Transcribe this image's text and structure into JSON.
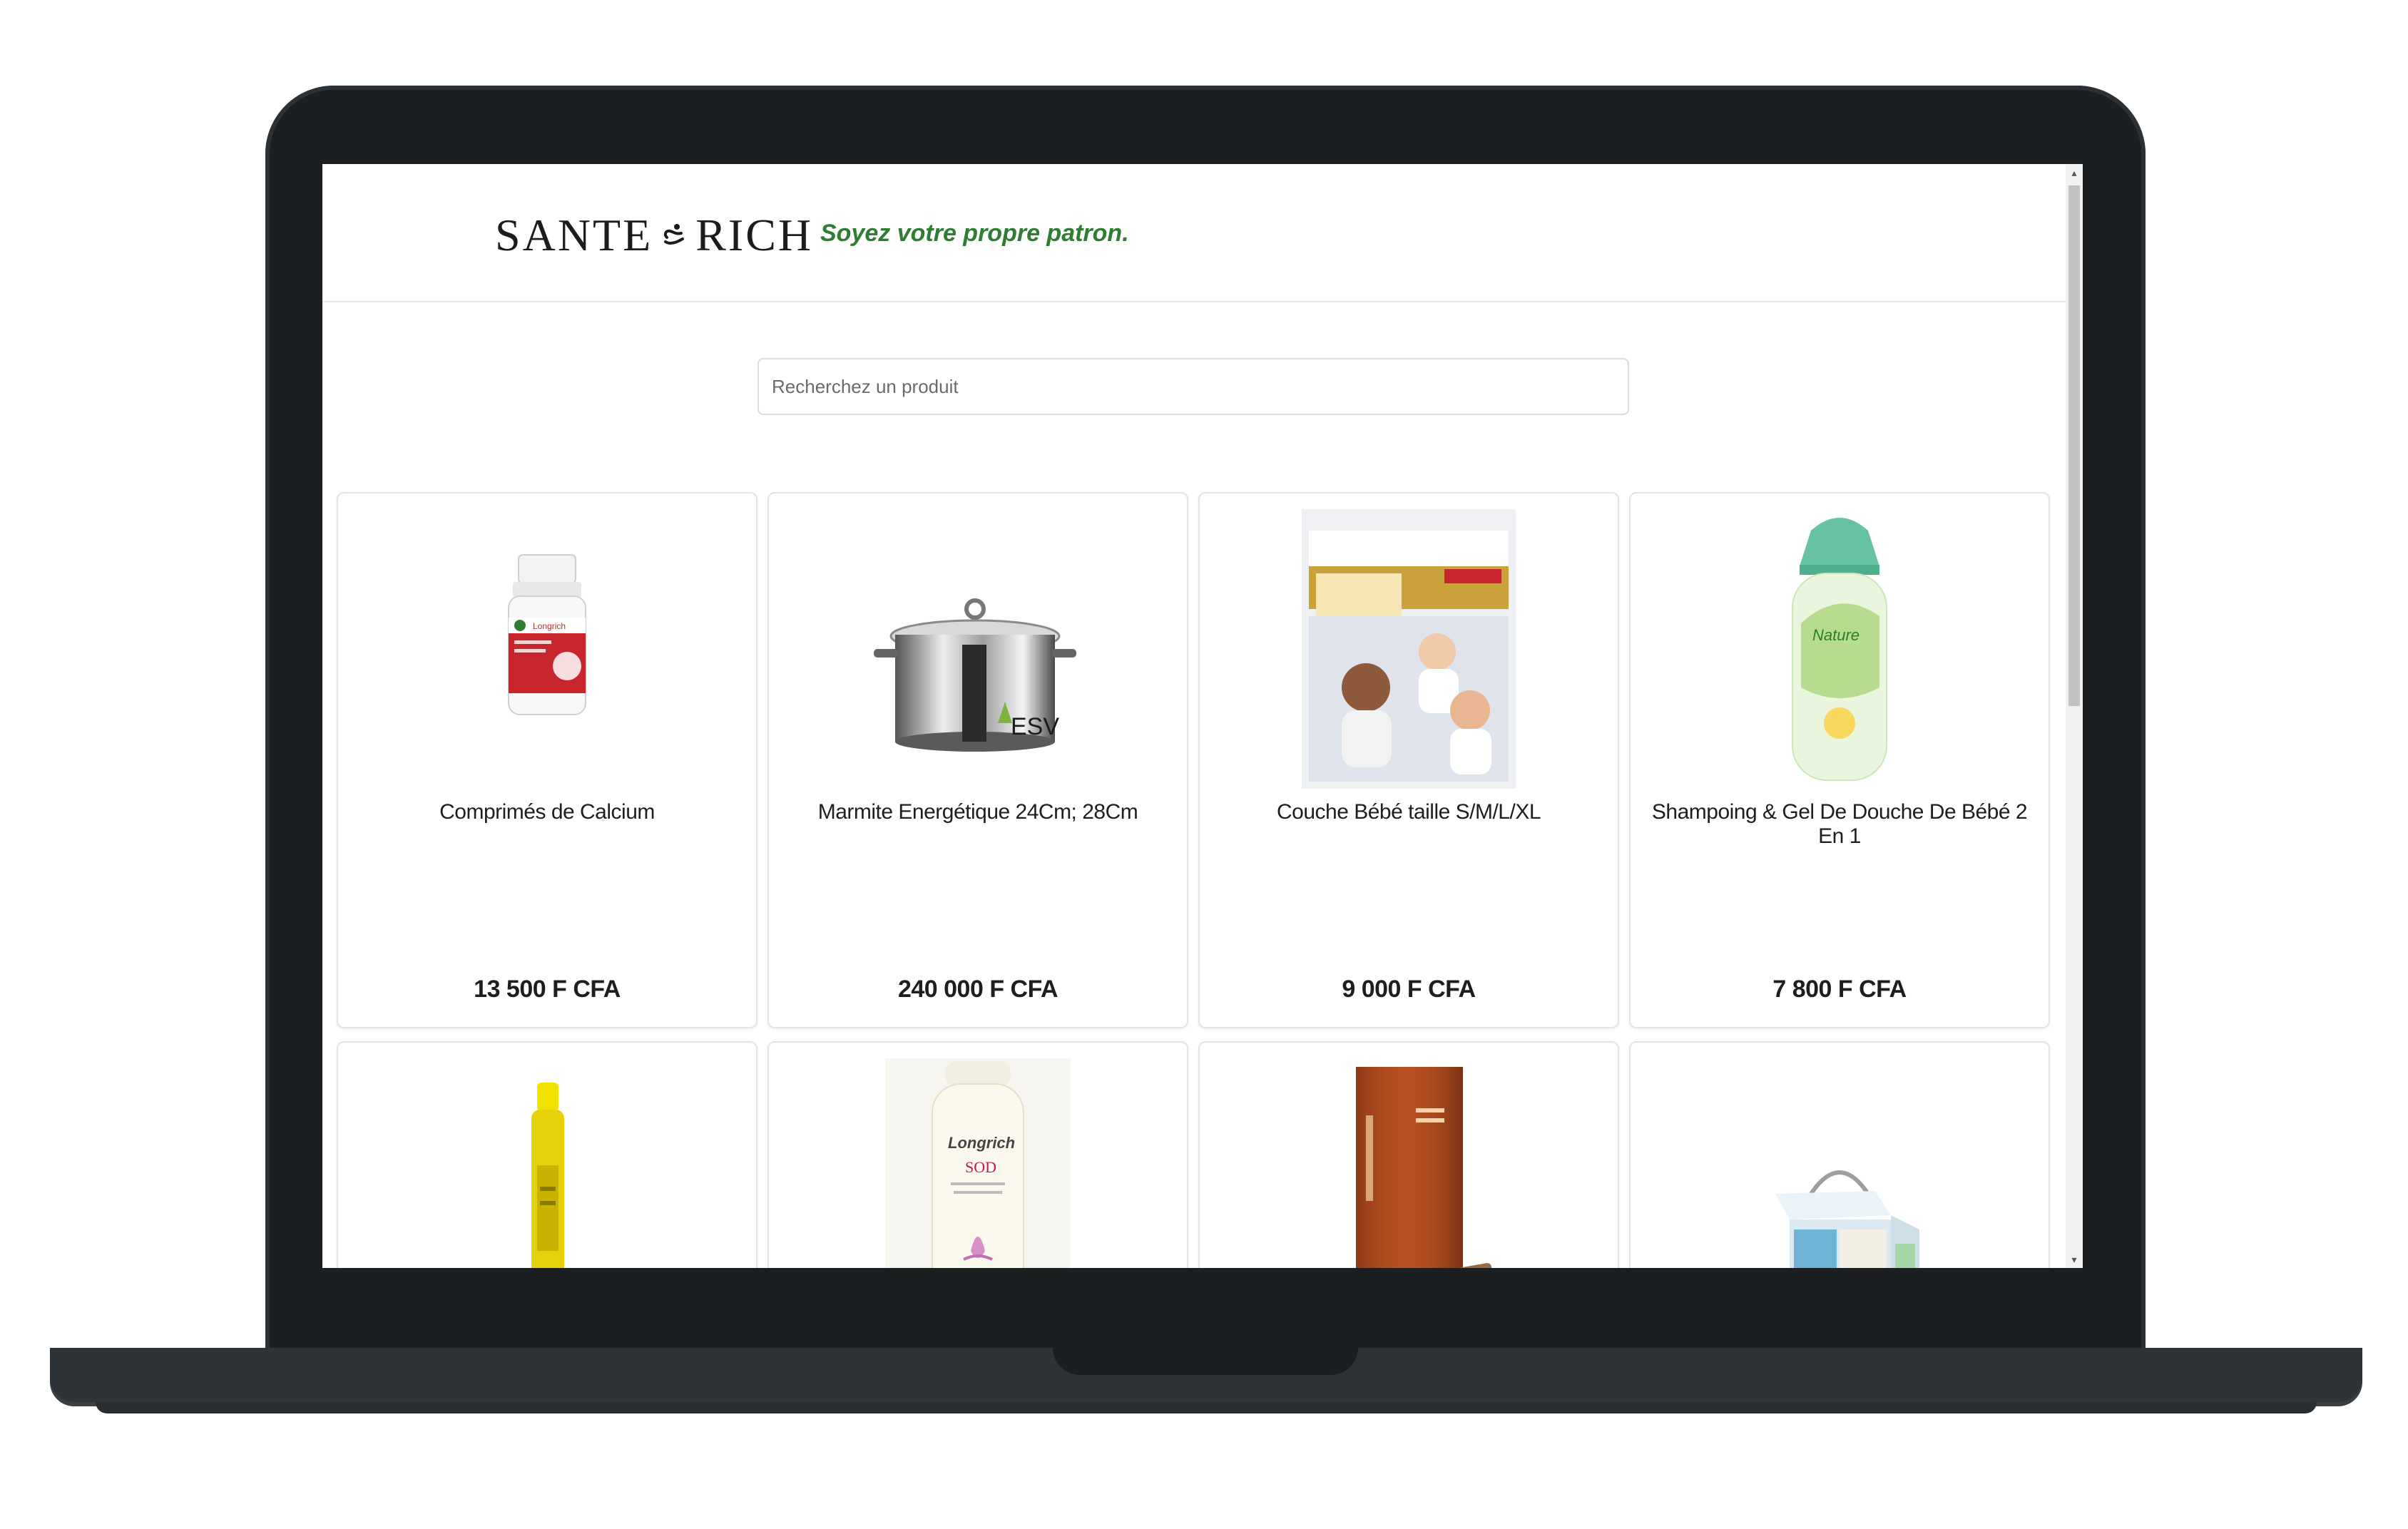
{
  "brand": {
    "logo_left": "SANTE",
    "logo_right": "RICH",
    "tagline": "Soyez votre propre patron.",
    "tagline_color": "#2e7d32"
  },
  "search": {
    "placeholder": "Recherchez un produit",
    "value": ""
  },
  "products": [
    {
      "name": "Comprimés de Calcium",
      "price": "13 500 F CFA",
      "icon": "calcium-bottle-icon"
    },
    {
      "name": "Marmite Energétique 24Cm; 28Cm",
      "price": "240 000 F CFA",
      "icon": "cooking-pot-icon"
    },
    {
      "name": "Couche Bébé taille S/M/L/XL",
      "price": "9 000 F CFA",
      "icon": "diaper-pack-icon"
    },
    {
      "name": "Shampoing & Gel De Douche De Bébé 2 En 1",
      "price": "7 800 F CFA",
      "icon": "baby-shampoo-bottle-icon"
    },
    {
      "name": "",
      "price": "",
      "icon": "yellow-tube-icon"
    },
    {
      "name": "",
      "price": "",
      "icon": "lotion-bottle-icon"
    },
    {
      "name": "",
      "price": "",
      "icon": "coffee-box-icon"
    },
    {
      "name": "",
      "price": "",
      "icon": "gift-box-icon"
    }
  ]
}
